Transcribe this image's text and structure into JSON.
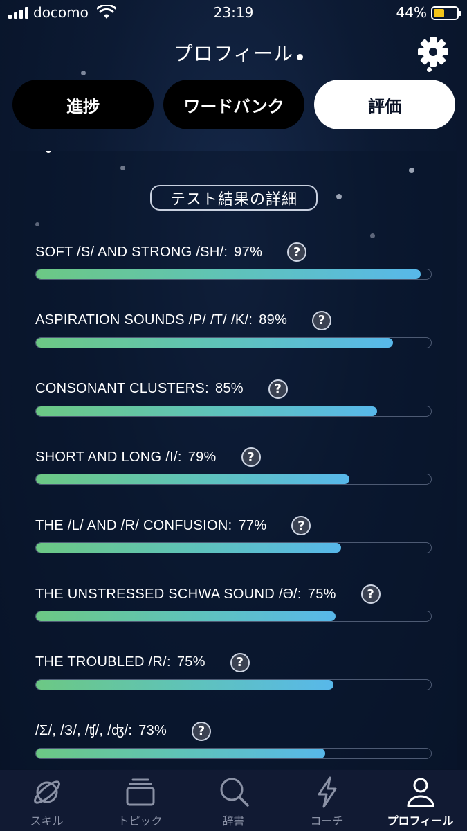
{
  "status_bar": {
    "carrier": "docomo",
    "time": "23:19",
    "battery_percent": "44%",
    "battery_level": 0.44
  },
  "header": {
    "title": "プロフィール",
    "settings_icon": "gear-icon"
  },
  "tabs": [
    {
      "label": "進捗",
      "active": false
    },
    {
      "label": "ワードバンク",
      "active": false
    },
    {
      "label": "評価",
      "active": true
    }
  ],
  "section": {
    "title": "テスト結果の詳細"
  },
  "results": [
    {
      "label": "SOFT /S/ AND STRONG /SH/:",
      "value": "97%",
      "fraction": 0.97
    },
    {
      "label": "ASPIRATION SOUNDS /P/ /T/ /K/:",
      "value": "89%",
      "fraction": 0.9
    },
    {
      "label": "CONSONANT CLUSTERS:",
      "value": "85%",
      "fraction": 0.86
    },
    {
      "label": "SHORT AND LONG /I/:",
      "value": "79%",
      "fraction": 0.79
    },
    {
      "label": "THE /L/ AND /R/ CONFUSION:",
      "value": "77%",
      "fraction": 0.77
    },
    {
      "label": "THE UNSTRESSED SCHWA SOUND /Ə/:",
      "value": "75%",
      "fraction": 0.755
    },
    {
      "label": "THE TROUBLED /R/:",
      "value": "75%",
      "fraction": 0.75
    },
    {
      "label": "/Σ/, /З/, /ʧ/, /ʤ/:",
      "value": "73%",
      "fraction": 0.73
    }
  ],
  "bottom_nav": [
    {
      "label": "スキル",
      "icon": "planet-icon",
      "active": false
    },
    {
      "label": "トピック",
      "icon": "stack-icon",
      "active": false
    },
    {
      "label": "辞書",
      "icon": "search-icon",
      "active": false
    },
    {
      "label": "コーチ",
      "icon": "lightning-icon",
      "active": false
    },
    {
      "label": "プロフィール",
      "icon": "person-icon",
      "active": true
    }
  ],
  "colors": {
    "bar_gradient_start": "#6cc884",
    "bar_gradient_end": "#58b8ea",
    "active_tab_bg": "#ffffff",
    "inactive_tab_bg": "#000000"
  }
}
